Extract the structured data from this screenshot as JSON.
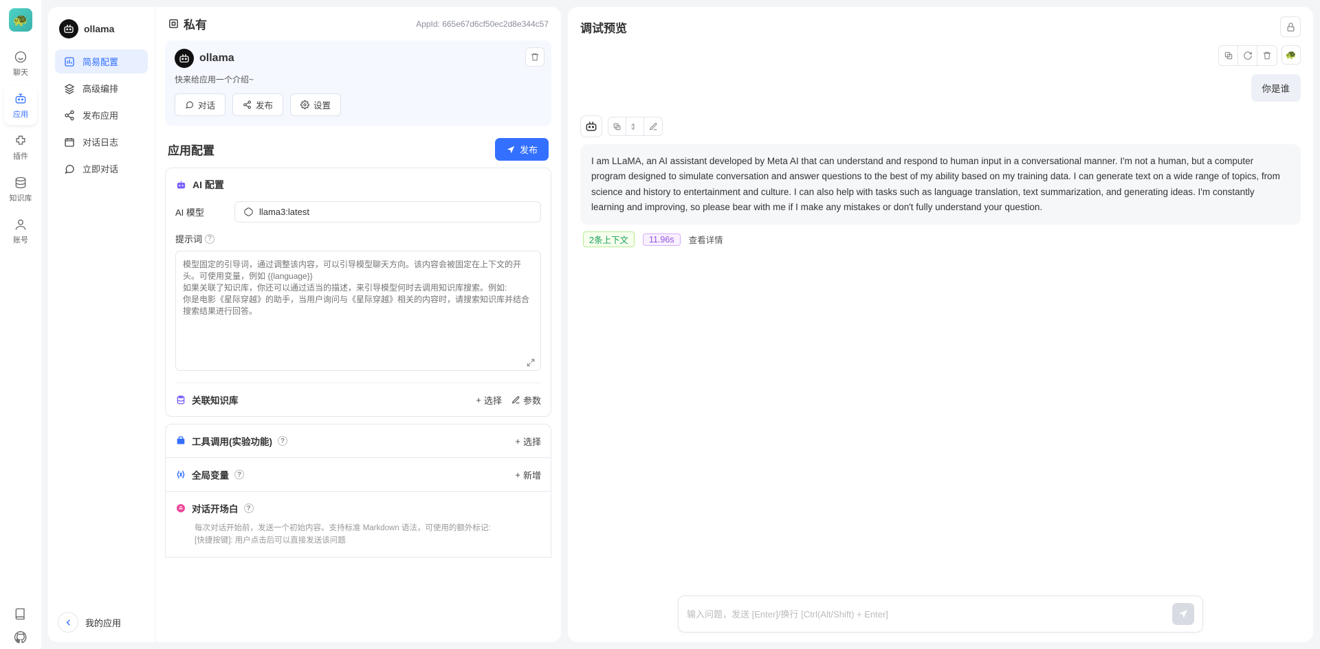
{
  "rail": {
    "items": [
      "聊天",
      "应用",
      "插件",
      "知识库",
      "账号"
    ],
    "active_index": 1
  },
  "app": {
    "name": "ollama",
    "nav": [
      {
        "label": "简易配置"
      },
      {
        "label": "高级编排"
      },
      {
        "label": "发布应用"
      },
      {
        "label": "对话日志"
      },
      {
        "label": "立即对话"
      }
    ],
    "nav_active": 0,
    "back_label": "我的应用"
  },
  "mid": {
    "scope": "私有",
    "appid_prefix": "AppId:",
    "appid": "665e67d6cf50ec2d8e344c57",
    "intro": {
      "title": "ollama",
      "sub": "快来给应用一个介绍~",
      "actions": [
        "对话",
        "发布",
        "设置"
      ]
    },
    "section_title": "应用配置",
    "publish_btn": "发布",
    "ai_config_title": "AI 配置",
    "model_label": "AI 模型",
    "model_value": "llama3:latest",
    "prompt_label": "提示词",
    "prompt_placeholder": "模型固定的引导词，通过调整该内容，可以引导模型聊天方向。该内容会被固定在上下文的开头。可使用变量，例如 {{language}}\n如果关联了知识库，你还可以通过适当的描述，来引导模型何时去调用知识库搜索。例如:\n你是电影《星际穿越》的助手，当用户询问与《星际穿越》相关的内容时，请搜索知识库并结合搜索结果进行回答。",
    "rows": {
      "kb": {
        "title": "关联知识库",
        "select": "选择",
        "params": "参数"
      },
      "tool": {
        "title": "工具调用(实验功能)",
        "select": "选择"
      },
      "vars": {
        "title": "全局变量",
        "add": "新增"
      },
      "opening": {
        "title": "对话开场白",
        "desc": "每次对话开始前，发送一个初始内容。支持标准 Markdown 语法，可使用的额外标记:\n[快捷按键]: 用户点击后可以直接发送该问题"
      }
    }
  },
  "preview": {
    "title": "调试预览",
    "user_msg": "你是谁",
    "bot_msg": "I am LLaMA, an AI assistant developed by Meta AI that can understand and respond to human input in a conversational manner. I'm not a human, but a computer program designed to simulate conversation and answer questions to the best of my ability based on my training data. I can generate text on a wide range of topics, from science and history to entertainment and culture. I can also help with tasks such as language translation, text summarization, and generating ideas. I'm constantly learning and improving, so please bear with me if I make any mistakes or don't fully understand your question.",
    "context_tag": "2条上下文",
    "time_tag": "11.96s",
    "detail": "查看详情",
    "input_placeholder": "输入问题，发送 [Enter]/换行 [Ctrl(Alt/Shift) + Enter]"
  }
}
